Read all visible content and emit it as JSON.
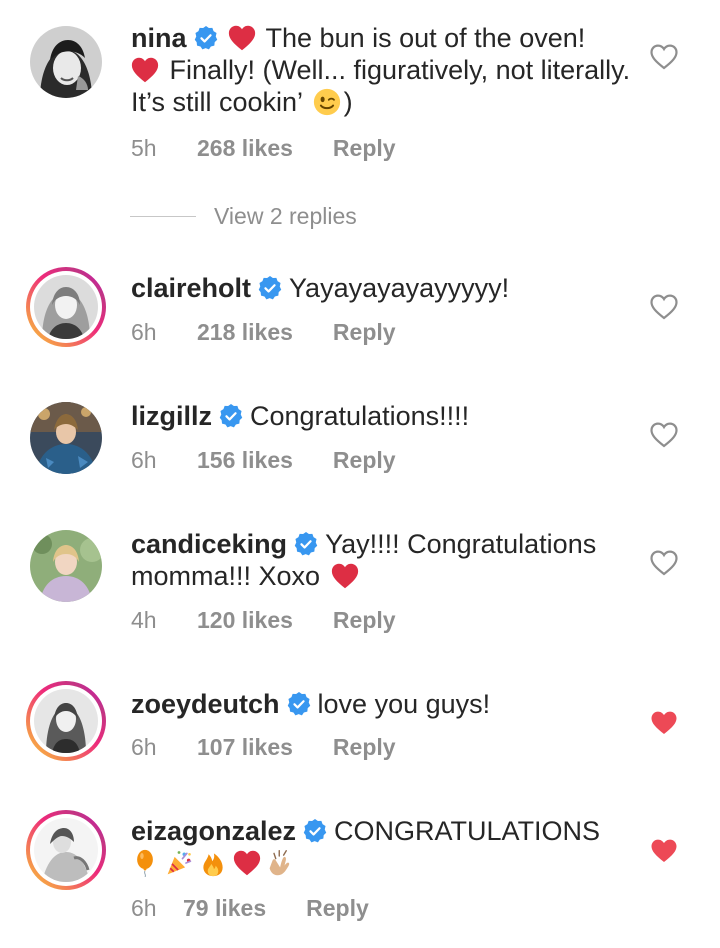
{
  "comments": [
    {
      "username": "nina",
      "text_parts": [
        "The bun is out of the oven!",
        "Finally! (Well... figuratively, not literally. It’s still cookin’",
        ")"
      ],
      "time": "5h",
      "likes": "268 likes",
      "reply": "Reply",
      "liked": false
    },
    {
      "username": "claireholt",
      "text_parts": [
        "Yayayayayayyyyy!"
      ],
      "time": "6h",
      "likes": "218 likes",
      "reply": "Reply",
      "liked": false
    },
    {
      "username": "lizgillz",
      "text_parts": [
        "Congratulations!!!!"
      ],
      "time": "6h",
      "likes": "156 likes",
      "reply": "Reply",
      "liked": false
    },
    {
      "username": "candiceking",
      "text_parts": [
        "Yay!!!! Congratulations",
        "momma!!! Xoxo"
      ],
      "time": "4h",
      "likes": "120 likes",
      "reply": "Reply",
      "liked": false
    },
    {
      "username": "zoeydeutch",
      "text_parts": [
        "love you guys!"
      ],
      "time": "6h",
      "likes": "107 likes",
      "reply": "Reply",
      "liked": true
    },
    {
      "username": "eizagonzalez",
      "text_parts": [
        "CONGRATULATIONS"
      ],
      "time": "6h",
      "likes": "79 likes",
      "reply": "Reply",
      "liked": true
    }
  ],
  "view_replies": "View 2 replies",
  "colors": {
    "text": "#262626",
    "muted": "#8e8e8e",
    "verified": "#3897f0",
    "liked_heart": "#ed4956",
    "story_ring": [
      "#f9ce34",
      "#ee2a7b",
      "#c13584"
    ]
  },
  "icons": {
    "verified": "verified-badge-icon",
    "heart": "heart-icon",
    "emoji": [
      "red-heart-emoji",
      "winking-face-emoji",
      "balloon-emoji",
      "party-popper-emoji",
      "fire-emoji",
      "clapping-hands-emoji"
    ]
  }
}
